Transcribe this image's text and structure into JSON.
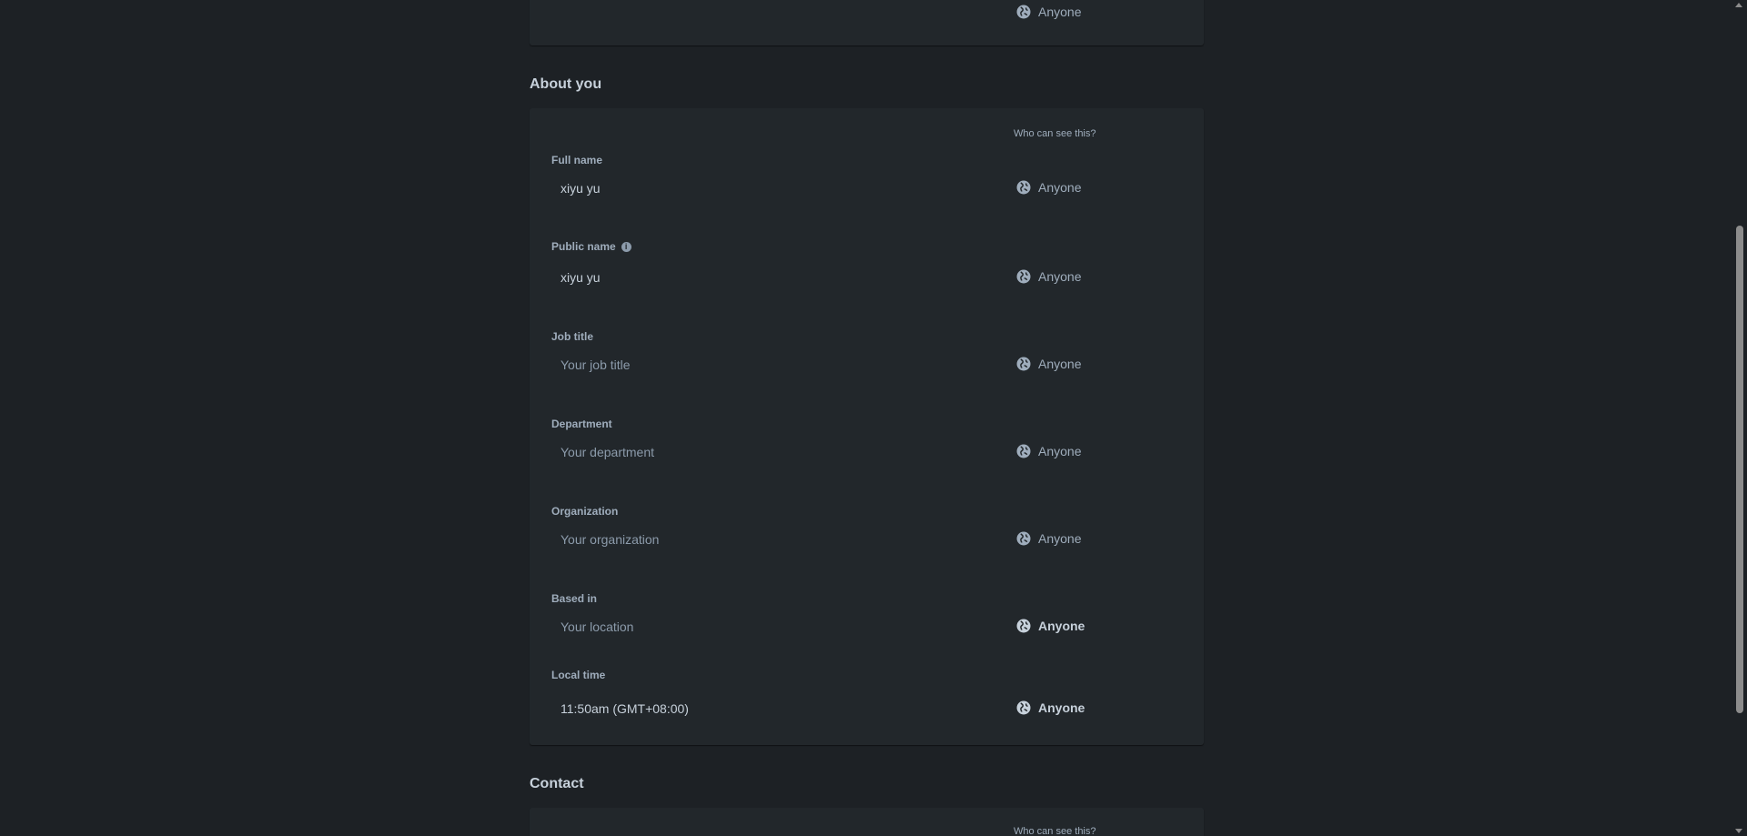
{
  "previous_section": {
    "visibility": "Anyone"
  },
  "about_you": {
    "title": "About you",
    "who_can_see": "Who can see this?",
    "fields": [
      {
        "label": "Full name",
        "value": "xiyu yu",
        "placeholder": "",
        "visibility": "Anyone"
      },
      {
        "label": "Public name",
        "value": "xiyu yu",
        "placeholder": "",
        "visibility": "Anyone"
      },
      {
        "label": "Job title",
        "value": "",
        "placeholder": "Your job title",
        "visibility": "Anyone"
      },
      {
        "label": "Department",
        "value": "",
        "placeholder": "Your department",
        "visibility": "Anyone"
      },
      {
        "label": "Organization",
        "value": "",
        "placeholder": "Your organization",
        "visibility": "Anyone"
      },
      {
        "label": "Based in",
        "value": "",
        "placeholder": "Your location",
        "visibility": "Anyone"
      },
      {
        "label": "Local time",
        "value": "11:50am (GMT+08:00)",
        "placeholder": "",
        "visibility": "Anyone"
      }
    ]
  },
  "contact": {
    "title": "Contact",
    "who_can_see": "Who can see this?"
  },
  "colors": {
    "background": "#1d2125",
    "card": "#22272b",
    "text": "#b6c2cf",
    "muted": "#9fadbc"
  },
  "icons": {
    "visibility": "globe-icon",
    "info": "info-icon"
  }
}
